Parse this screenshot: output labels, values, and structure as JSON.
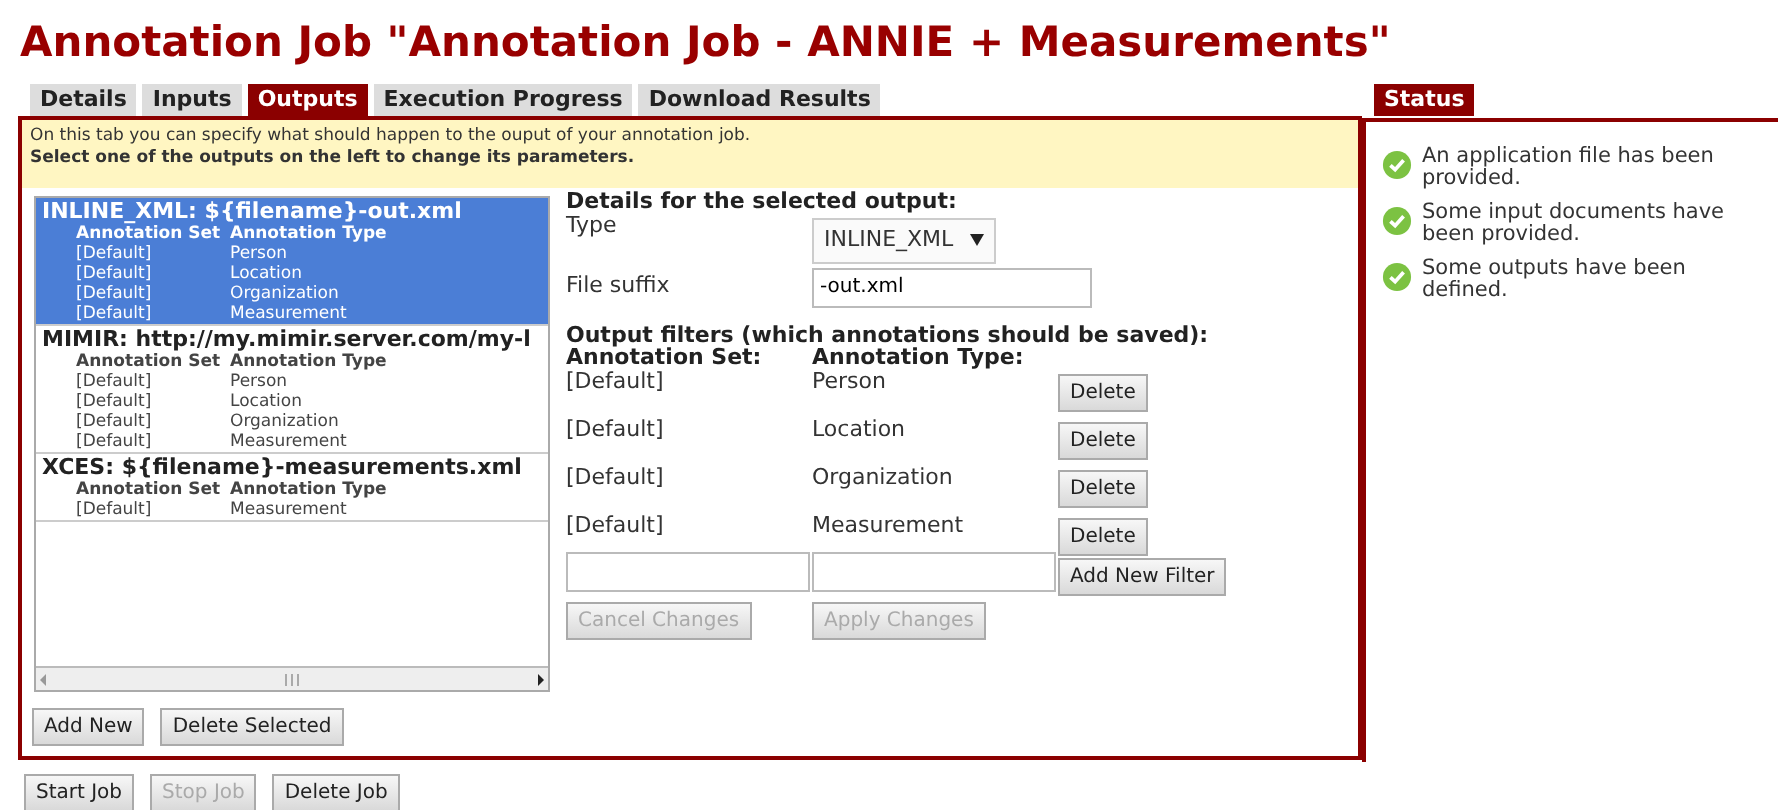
{
  "title": "Annotation Job \"Annotation Job - ANNIE + Measurements\"",
  "tabs": [
    {
      "label": "Details",
      "selected": false
    },
    {
      "label": "Inputs",
      "selected": false
    },
    {
      "label": "Outputs",
      "selected": true
    },
    {
      "label": "Execution Progress",
      "selected": false
    },
    {
      "label": "Download Results",
      "selected": false
    }
  ],
  "info": {
    "text": "On this tab you can specify what should happen to the ouput of your annotation job.",
    "instruction": "Select one of the outputs on the left to change its parameters."
  },
  "outputs": [
    {
      "title": "INLINE_XML: ${filename}-out.xml",
      "selected": true,
      "columns": [
        "Annotation Set",
        "Annotation Type"
      ],
      "rows": [
        [
          "[Default]",
          "Person"
        ],
        [
          "[Default]",
          "Location"
        ],
        [
          "[Default]",
          "Organization"
        ],
        [
          "[Default]",
          "Measurement"
        ]
      ]
    },
    {
      "title": "MIMIR: http://my.mimir.server.com/my-l",
      "selected": false,
      "columns": [
        "Annotation Set",
        "Annotation Type"
      ],
      "rows": [
        [
          "[Default]",
          "Person"
        ],
        [
          "[Default]",
          "Location"
        ],
        [
          "[Default]",
          "Organization"
        ],
        [
          "[Default]",
          "Measurement"
        ]
      ]
    },
    {
      "title": "XCES: ${filename}-measurements.xml",
      "selected": false,
      "columns": [
        "Annotation Set",
        "Annotation Type"
      ],
      "rows": [
        [
          "[Default]",
          "Measurement"
        ]
      ]
    }
  ],
  "list_buttons": [
    {
      "label": "Add New",
      "disabled": false
    },
    {
      "label": "Delete Selected",
      "disabled": false
    }
  ],
  "details": {
    "heading": "Details for the selected output:",
    "type_label": "Type",
    "type_value": "INLINE_XML",
    "suffix_label": "File suffix",
    "suffix_value": "-out.xml",
    "filters_heading": "Output filters (which annotations should be saved):",
    "set_heading": "Annotation Set:",
    "type_heading": "Annotation Type:",
    "filters": [
      {
        "set": "[Default]",
        "type": "Person",
        "button": "Delete"
      },
      {
        "set": "[Default]",
        "type": "Location",
        "button": "Delete"
      },
      {
        "set": "[Default]",
        "type": "Organization",
        "button": "Delete"
      },
      {
        "set": "[Default]",
        "type": "Measurement",
        "button": "Delete"
      }
    ],
    "add_filter_button": "Add New Filter",
    "actions": [
      {
        "label": "Cancel Changes",
        "disabled": true
      },
      {
        "label": "Apply Changes",
        "disabled": true
      }
    ]
  },
  "status": {
    "tab": "Status",
    "items": [
      {
        "text": "An application file has been provided.",
        "done": true
      },
      {
        "text": "Some input documents have been provided.",
        "done": true
      },
      {
        "text": "Some outputs have been defined.",
        "done": true
      }
    ]
  },
  "job_buttons": [
    {
      "label": "Start Job",
      "disabled": false
    },
    {
      "label": "Stop Job",
      "disabled": true
    },
    {
      "label": "Delete Job",
      "disabled": false
    }
  ]
}
